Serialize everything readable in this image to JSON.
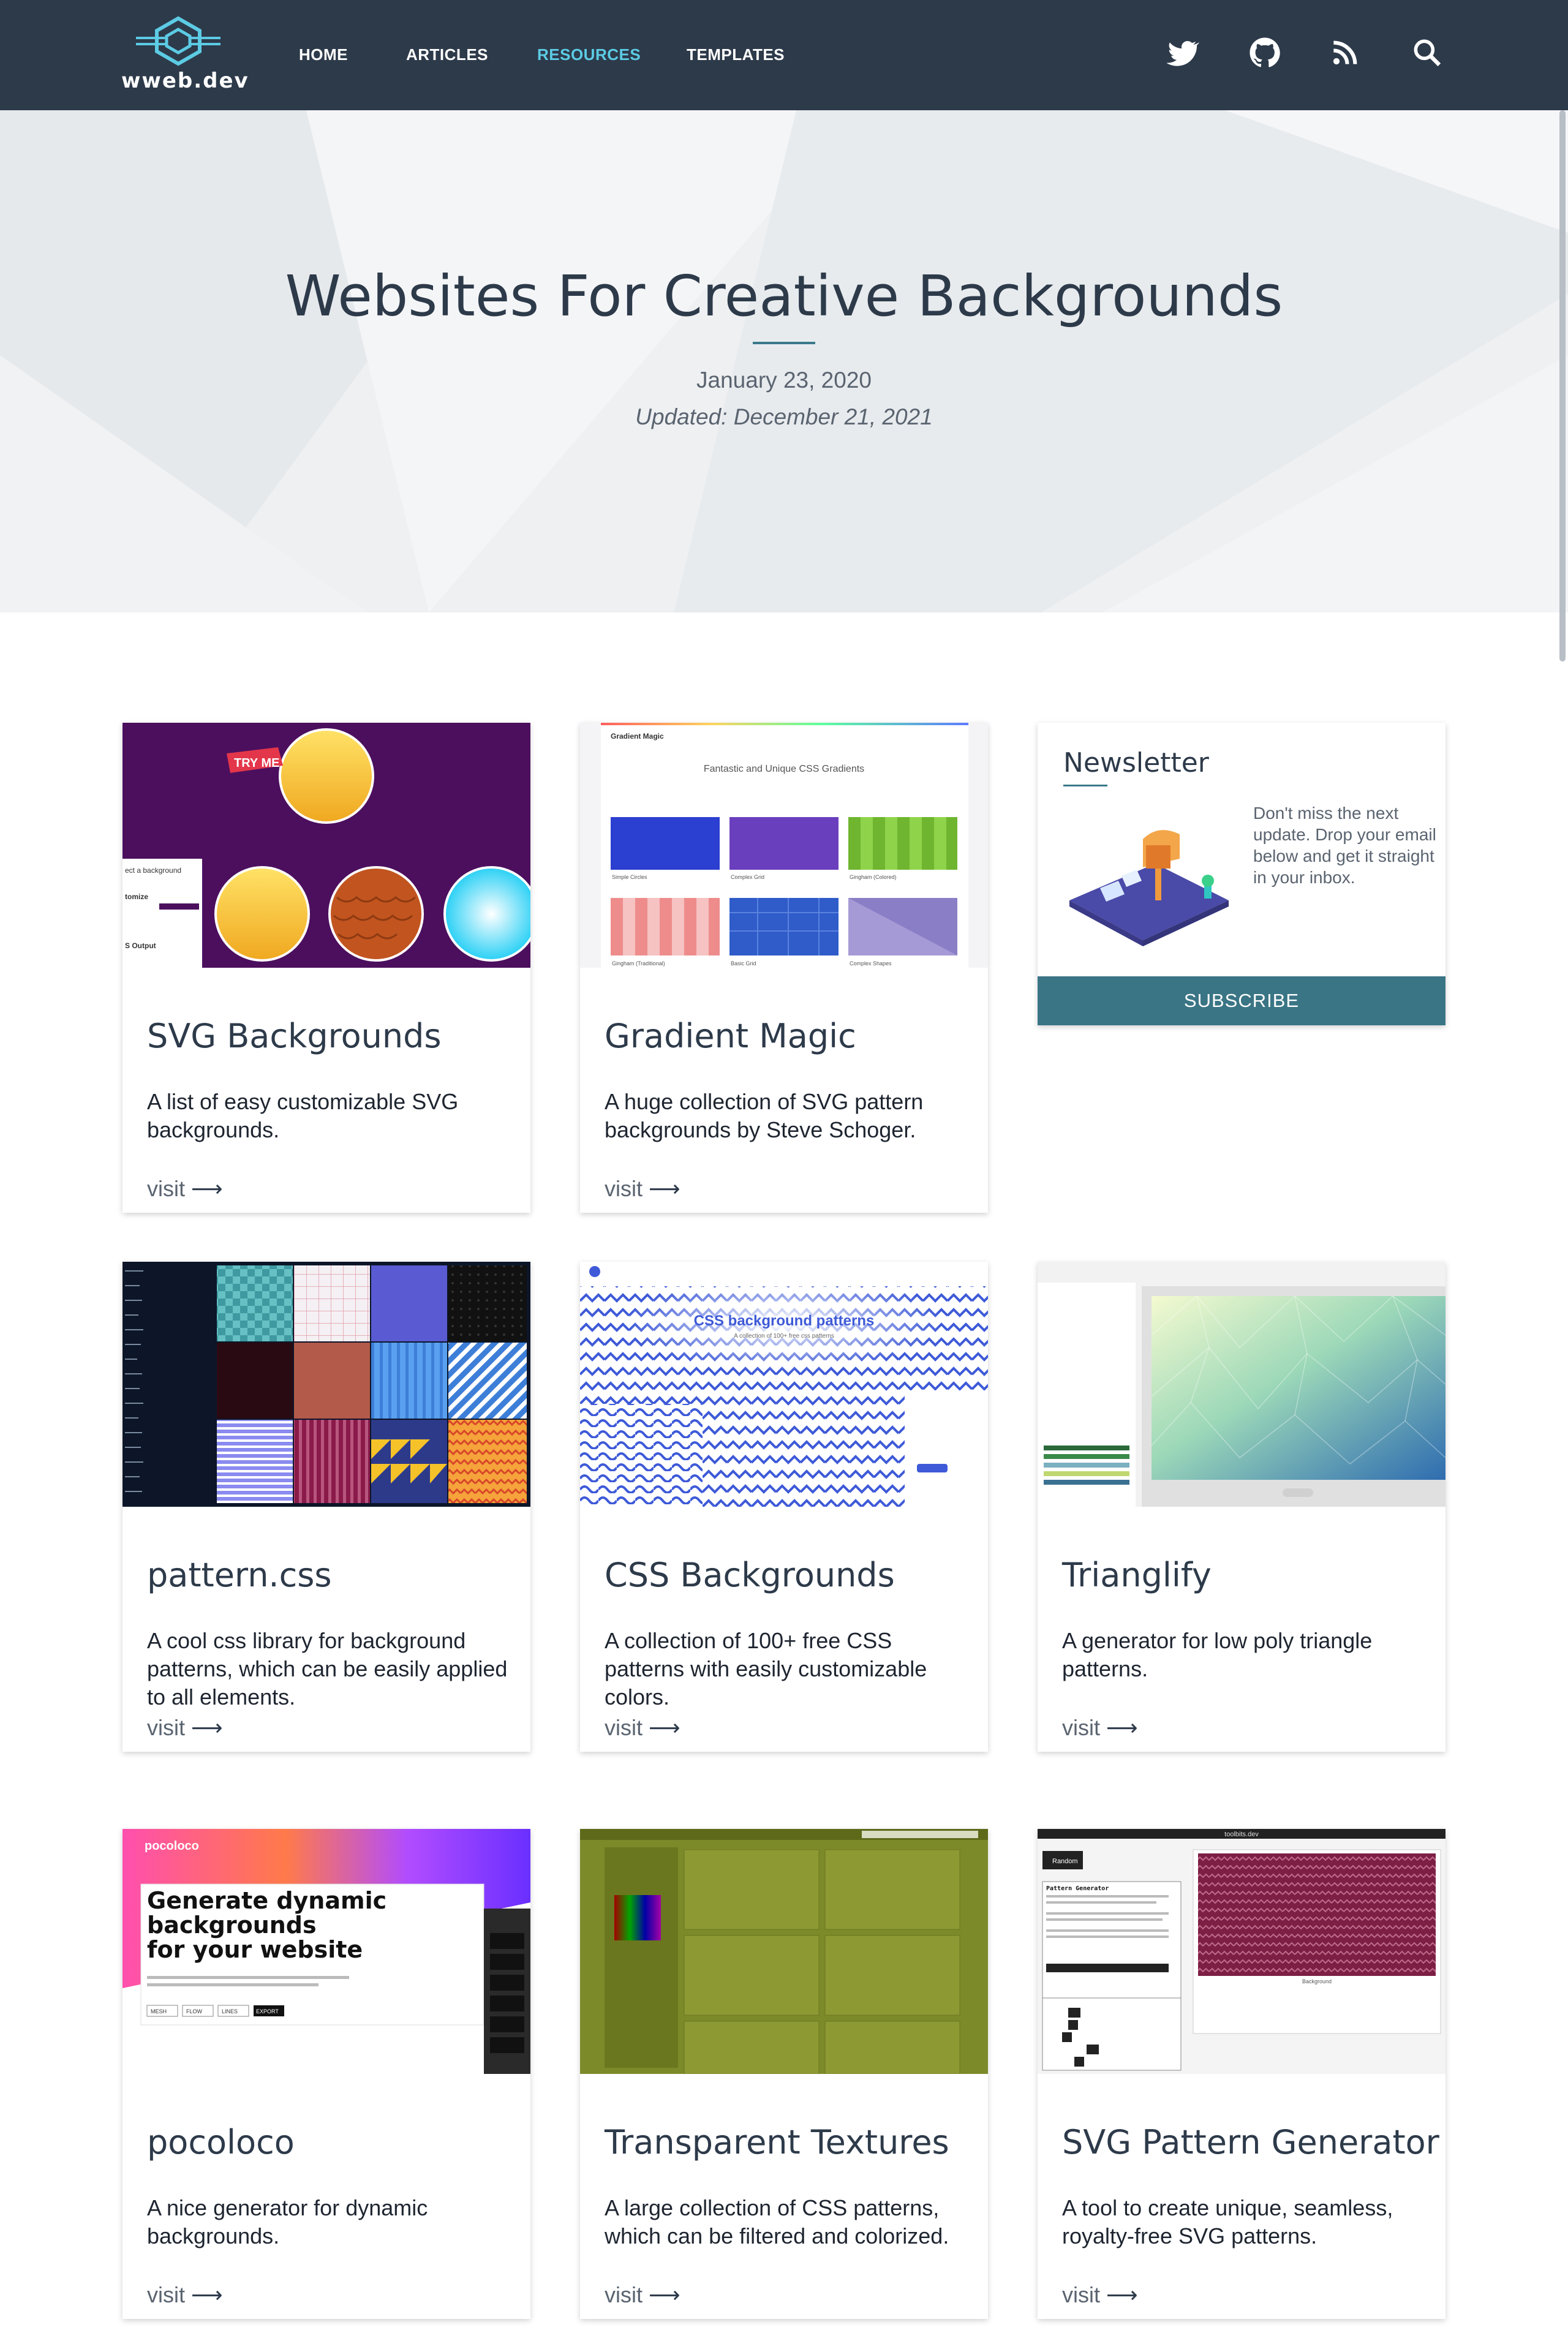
{
  "site": {
    "logo_text": "wweb.dev",
    "nav": [
      {
        "label": "HOME"
      },
      {
        "label": "ARTICLES"
      },
      {
        "label": "RESOURCES"
      },
      {
        "label": "TEMPLATES"
      }
    ],
    "active_nav": "RESOURCES",
    "icons": [
      "twitter-icon",
      "github-icon",
      "rss-icon",
      "search-icon"
    ]
  },
  "hero": {
    "title": "Websites For Creative Backgrounds",
    "date": "January 23, 2020",
    "updated": "Updated: December 21, 2021"
  },
  "newsletter": {
    "title": "Newsletter",
    "text": "Don't miss the next update. Drop your email below and get it straight in your inbox.",
    "button": "SUBSCRIBE"
  },
  "cards": [
    {
      "title": "SVG Backgrounds",
      "description": "A list of easy customizable SVG backgrounds.",
      "link": "visit"
    },
    {
      "title": "Gradient Magic",
      "description": "A huge collection of SVG pattern backgrounds by Steve Schoger.",
      "link": "visit"
    },
    {
      "title": "pattern.css",
      "description": "A cool css library for background patterns, which can be easily applied to all elements.",
      "link": "visit"
    },
    {
      "title": "CSS Backgrounds",
      "description": "A collection of 100+ free CSS patterns with easily customizable colors.",
      "link": "visit"
    },
    {
      "title": "Trianglify",
      "description": "A generator for low poly triangle patterns.",
      "link": "visit"
    },
    {
      "title": "pocoloco",
      "description": "A nice generator for dynamic backgrounds.",
      "link": "visit"
    },
    {
      "title": "Transparent Textures",
      "description": "A large collection of CSS patterns, which can be filtered and colorized.",
      "link": "visit"
    },
    {
      "title": "SVG Pattern Generator",
      "description": "A tool to create unique, seamless, royalty-free SVG patterns.",
      "link": "visit"
    }
  ],
  "thumbnails": {
    "svg_backgrounds": {
      "badge": "TRY ME",
      "panel_labels": [
        "ect a background",
        "tomize",
        "S Output"
      ]
    },
    "gradient_magic": {
      "brand": "Gradient Magic",
      "heading": "Fantastic and Unique CSS Gradients",
      "tiles": [
        "Simple Circles",
        "Complex Grid",
        "Gingham (Colored)",
        "Gingham (Traditional)",
        "Basic Grid",
        "Complex Shapes"
      ]
    },
    "css_backgrounds": {
      "heading": "CSS background patterns",
      "sub": "A collection of 100+ free css patterns"
    },
    "pocoloco": {
      "brand": "pocoloco",
      "headline1": "Generate dynamic",
      "headline2": "backgrounds",
      "headline3": "for your website",
      "buttons": [
        "MESH",
        "FLOW",
        "LINES",
        "EXPORT"
      ]
    },
    "svg_pattern_generator": {
      "topbar": "toolbits.dev",
      "panel": "Pattern Generator",
      "button": "Random",
      "caption": "Background"
    }
  },
  "colors": {
    "navbar": "#2d3a4a",
    "active": "#5ccbe4",
    "accent": "#3a7585",
    "text": "#2d3a4a"
  }
}
